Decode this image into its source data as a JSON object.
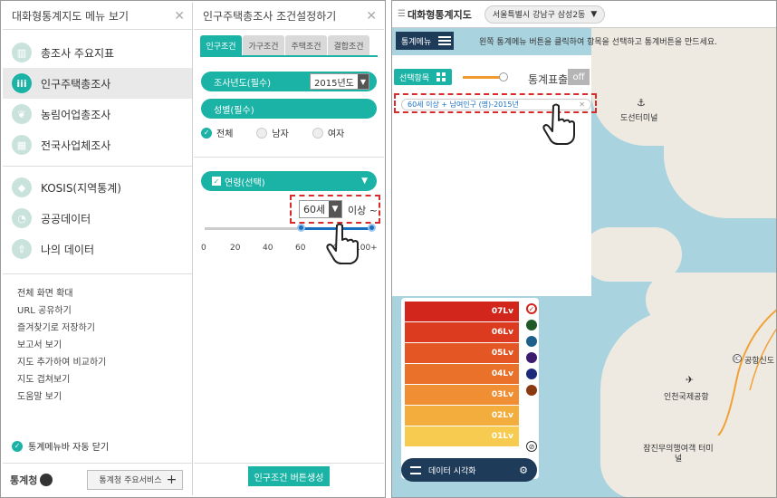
{
  "left_panel": {
    "menu_title": "대화형통계지도 메뉴 보기",
    "menu_items": [
      {
        "label": "총조사 주요지표",
        "icon": "chart-icon"
      },
      {
        "label": "인구주택총조사",
        "icon": "people-icon"
      },
      {
        "label": "농림어업총조사",
        "icon": "leaf-icon"
      },
      {
        "label": "전국사업체조사",
        "icon": "building-icon"
      }
    ],
    "menu_items2": [
      {
        "label": "KOSIS(지역통계)",
        "icon": "map-icon"
      },
      {
        "label": "공공데이터",
        "icon": "pie-icon"
      },
      {
        "label": "나의 데이터",
        "icon": "upload-icon"
      }
    ],
    "tools": [
      "전체 화면 확대",
      "URL 공유하기",
      "즐겨찾기로 저장하기",
      "보고서 보기",
      "지도 추가하여 비교하기",
      "지도 겹쳐보기",
      "도움말 보기"
    ],
    "auto_close": "통계메뉴바 자동 닫기",
    "logo": "통계청",
    "service_button": "통계청 주요서비스"
  },
  "condition_panel": {
    "title": "인구주택총조사 조건설정하기",
    "tabs": [
      "인구조건",
      "가구조건",
      "주택조건",
      "결합조건"
    ],
    "year_label": "조사년도(필수)",
    "year_value": "2015년도",
    "gender_label": "성별(필수)",
    "gender_options": [
      "전체",
      "남자",
      "여자"
    ],
    "age_label": "연령(선택)",
    "age_value": "60세",
    "age_suffix": "이상 ~",
    "ticks": [
      "0",
      "20",
      "40",
      "60",
      "80",
      "100+"
    ],
    "generate_button": "인구조건 버튼생성"
  },
  "map": {
    "app_title": "대화형통계지도",
    "region": "서울특별시 강남구 삼성2동",
    "stat_menu": "통계메뉴",
    "hint": "왼쪽 통계메뉴 버튼을 클릭하여 항목을 선택하고 통계버튼을 만드세요.",
    "selected_items": "선택항목",
    "stat_display": "통계표출",
    "off": "off",
    "tag": "60세 이상 + 남여인구 (명)-2015년",
    "levels": [
      {
        "label": "07Lv",
        "color": "#d2261c"
      },
      {
        "label": "06Lv",
        "color": "#dc3b1f"
      },
      {
        "label": "05Lv",
        "color": "#e45624"
      },
      {
        "label": "04Lv",
        "color": "#ea7129"
      },
      {
        "label": "03Lv",
        "color": "#ef8e33"
      },
      {
        "label": "02Lv",
        "color": "#f3ad3d"
      },
      {
        "label": "01Lv",
        "color": "#f7cb4f"
      }
    ],
    "palette": [
      "#d2261c",
      "#1e5a28",
      "#1c5f8a",
      "#3b1c6e",
      "#1b2a7a",
      "#8a3a12"
    ],
    "viz_label": "데이터 시각화",
    "places": [
      "도선터미널",
      "인천국제공항",
      "공항신도",
      "잠진무의행여객 터미널"
    ],
    "ic": "IC"
  }
}
